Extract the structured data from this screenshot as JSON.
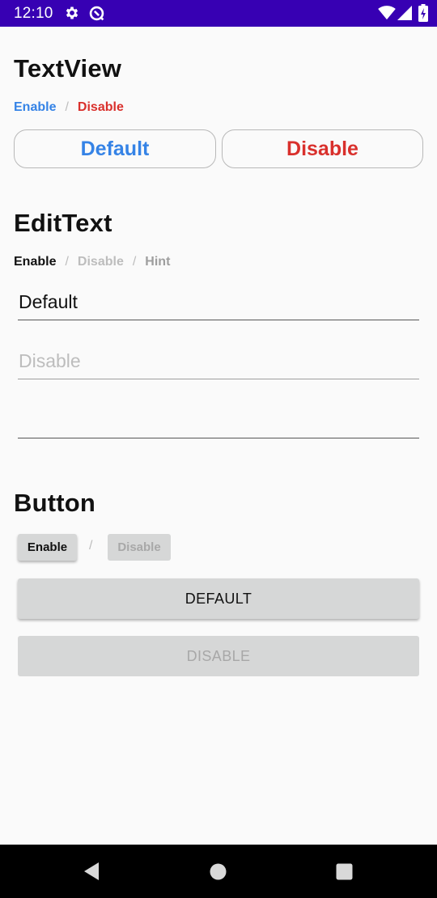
{
  "status_bar": {
    "time": "12:10",
    "background": "#3700b3"
  },
  "textview": {
    "title": "TextView",
    "enable_label": "Enable",
    "separator": "/",
    "disable_label": "Disable",
    "default_button": "Default",
    "disable_button": "Disable",
    "enable_color": "#3583e6",
    "disable_color": "#d9302c"
  },
  "edittext": {
    "title": "EditText",
    "enable_label": "Enable",
    "separator1": "/",
    "disable_label": "Disable",
    "separator2": "/",
    "hint_label": "Hint",
    "field_default_value": "Default",
    "field_disable_value": "Disable",
    "field_empty_value": ""
  },
  "button": {
    "title": "Button",
    "enable_label": "Enable",
    "separator": "/",
    "disable_label": "Disable",
    "default_button": "DEFAULT",
    "disable_button": "DISABLE"
  },
  "nav_bar": {
    "icons": [
      "back-icon",
      "home-icon",
      "recents-icon"
    ]
  }
}
